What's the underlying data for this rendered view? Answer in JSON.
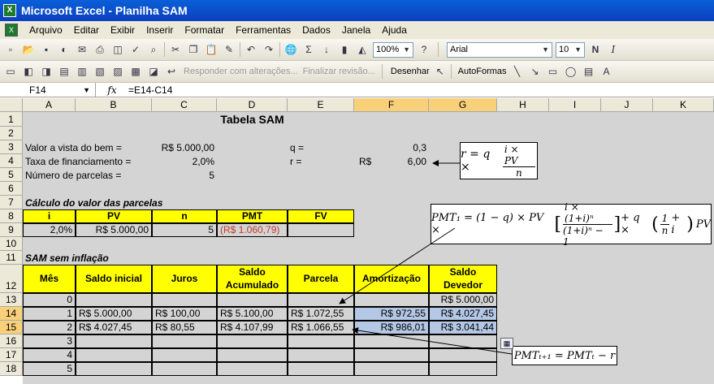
{
  "window": {
    "title": "Microsoft Excel - Planilha SAM"
  },
  "menu": [
    "Arquivo",
    "Editar",
    "Exibir",
    "Inserir",
    "Formatar",
    "Ferramentas",
    "Dados",
    "Janela",
    "Ajuda"
  ],
  "toolbar": {
    "zoom": "100%",
    "font": "Arial",
    "size": "10",
    "bold": "N",
    "italic": "I",
    "sigma": "Σ",
    "review_reply": "Responder com alterações...",
    "review_end": "Finalizar revisão...",
    "draw": "Desenhar",
    "autoshapes": "AutoFormas"
  },
  "formula_bar": {
    "name_box": "F14",
    "fx": "fx",
    "formula": "=E14-C14"
  },
  "columns": [
    "A",
    "B",
    "C",
    "D",
    "E",
    "F",
    "G",
    "H",
    "I",
    "J",
    "K"
  ],
  "rows": [
    "1",
    "2",
    "3",
    "4",
    "5",
    "6",
    "7",
    "8",
    "9",
    "10",
    "11",
    "12",
    "13",
    "14",
    "15",
    "16",
    "17",
    "18"
  ],
  "sheet": {
    "title": "Tabela SAM",
    "vista_label": "Valor a vista do bem =",
    "vista_value": "R$ 5.000,00",
    "taxa_label": "Taxa de financiamento =",
    "taxa_value": "2,0%",
    "parcelas_label": "Número de parcelas =",
    "parcelas_value": "5",
    "q_label": "q =",
    "q_value": "0,3",
    "r_label": "r =",
    "r_currency": "R$",
    "r_value": "6,00",
    "calc_title": "Cálculo do valor das parcelas",
    "calc_headers": [
      "i",
      "PV",
      "n",
      "PMT",
      "FV"
    ],
    "calc_values": [
      "2,0%",
      "R$ 5.000,00",
      "5",
      "(R$ 1.060,79)",
      ""
    ],
    "sam_title": "SAM sem inflação",
    "sam_headers": [
      "Mês",
      "Saldo inicial",
      "Juros",
      "Saldo Acumulado",
      "Parcela",
      "Amortização",
      "Saldo Devedor"
    ],
    "sam_rows": [
      [
        "0",
        "",
        "",
        "",
        "",
        "",
        "R$ 5.000,00"
      ],
      [
        "1",
        "R$ 5.000,00",
        "R$ 100,00",
        "R$ 5.100,00",
        "R$ 1.072,55",
        "R$ 972,55",
        "R$ 4.027,45"
      ],
      [
        "2",
        "R$ 4.027,45",
        "R$ 80,55",
        "R$ 4.107,99",
        "R$ 1.066,55",
        "R$ 986,01",
        "R$ 3.041,44"
      ],
      [
        "3",
        "",
        "",
        "",
        "",
        "",
        ""
      ],
      [
        "4",
        "",
        "",
        "",
        "",
        "",
        ""
      ],
      [
        "5",
        "",
        "",
        "",
        "",
        "",
        ""
      ]
    ]
  },
  "formulas": {
    "f1_lhs": "r = q ×",
    "f1_num": "i × PV",
    "f1_den": "n",
    "f2_lhs": "PMT₁ = (1 − q) × PV ×",
    "f2_num": "i × (1+i)ⁿ",
    "f2_den": "(1+i)ⁿ − 1",
    "f2_mid": "+ q ×",
    "f2_paren_num": "1",
    "f2_paren_den": "n",
    "f2_tail": "+ i",
    "f2_end": "PV",
    "f3": "PMTₜ₊₁ = PMTₜ − r"
  },
  "colors": {
    "title_bar": "#0b4fd0",
    "highlight_yellow": "#ffff00",
    "selection_blue": "#b4c8e6",
    "negative_red": "#c0392b"
  }
}
